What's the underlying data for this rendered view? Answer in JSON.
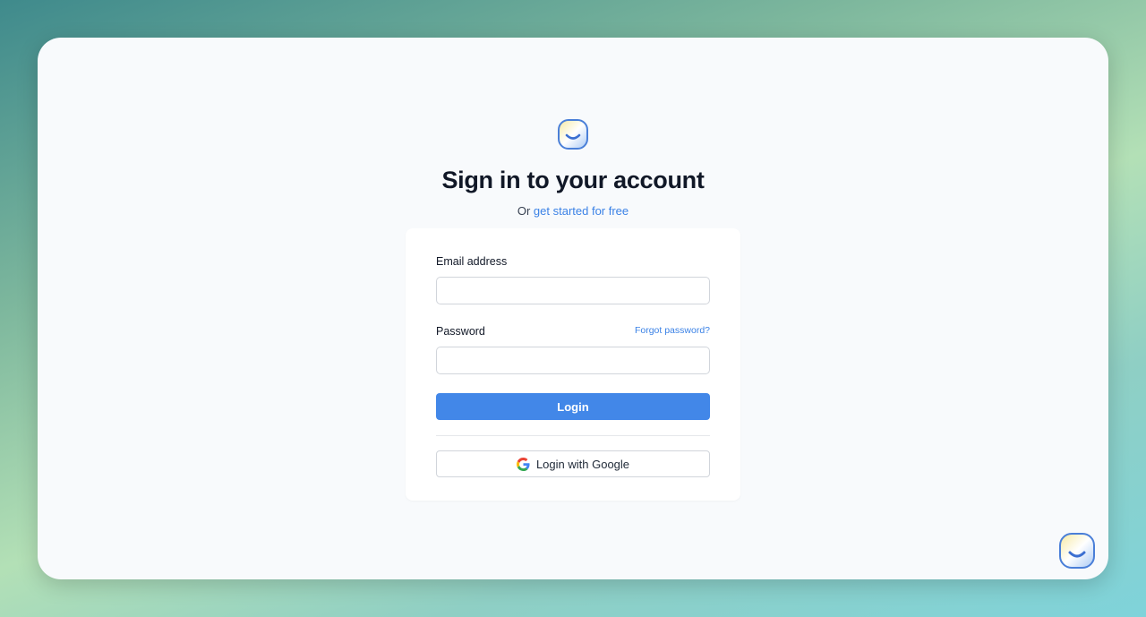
{
  "heading": {
    "title": "Sign in to your account",
    "subtitle_prefix": "Or",
    "signup_link": "get started for free"
  },
  "form": {
    "email_label": "Email address",
    "email_value": "",
    "password_label": "Password",
    "password_value": "",
    "forgot_link": "Forgot password?",
    "login_label": "Login",
    "google_label": "Login with Google"
  },
  "icons": {
    "logo": "smiley-logo-icon",
    "google": "google-g-icon",
    "chat": "chat-widget-icon"
  },
  "colors": {
    "accent": "#4287e8",
    "link": "#3b82e6",
    "title": "#111827"
  }
}
